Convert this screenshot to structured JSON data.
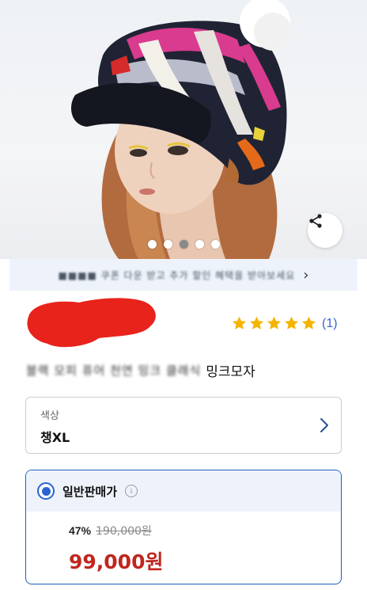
{
  "gallery": {
    "dots": 5,
    "active_dot": 3,
    "share_icon": "share-icon"
  },
  "banner": {
    "text": "■■■■ 쿠폰 다운 받고 추가 할인 혜택을 받아보세요",
    "chevron": "›"
  },
  "seller": {
    "masked": true
  },
  "rating": {
    "stars": 5,
    "count": "(1)",
    "color": "#f5b400"
  },
  "product": {
    "title_blurred": "블랙 모피 퓨어 천연 밍크 클래식",
    "title_visible": "밍크모자"
  },
  "option": {
    "label": "색상",
    "value": "챙XL",
    "chevron_icon": "chevron-right-icon"
  },
  "price": {
    "type": "일반판매가",
    "discount": "47%",
    "original": "190,000원",
    "sale": "99,000원",
    "accent": "#1f5fbf",
    "sale_color": "#c0261e"
  }
}
